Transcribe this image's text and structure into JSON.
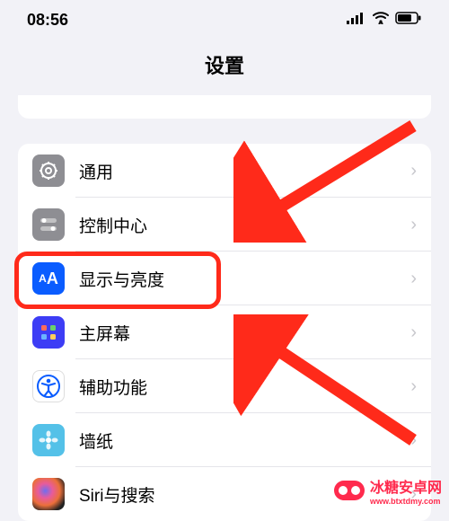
{
  "status": {
    "time": "08:56"
  },
  "title": "设置",
  "items": [
    {
      "label": "通用",
      "icon": "gear"
    },
    {
      "label": "控制中心",
      "icon": "switches"
    },
    {
      "label": "显示与亮度",
      "icon": "AA",
      "highlighted": true
    },
    {
      "label": "主屏幕",
      "icon": "grid"
    },
    {
      "label": "辅助功能",
      "icon": "accessibility"
    },
    {
      "label": "墙纸",
      "icon": "flower"
    },
    {
      "label": "Siri与搜索",
      "icon": "siri"
    }
  ],
  "watermark": {
    "text": "冰糖安卓网",
    "url_label": "www.btxtdmy.com"
  }
}
